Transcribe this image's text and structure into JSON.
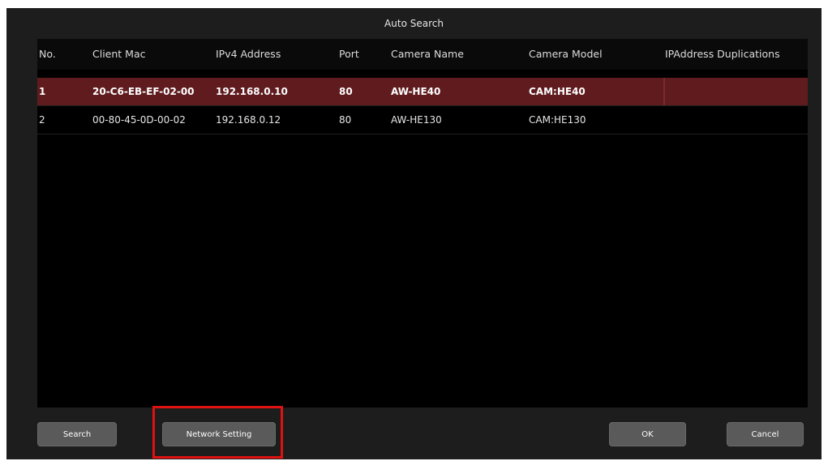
{
  "dialog": {
    "title": "Auto Search"
  },
  "table": {
    "headers": [
      "No.",
      "Client Mac",
      "IPv4 Address",
      "Port",
      "Camera Name",
      "Camera Model",
      "IPAddress Duplications"
    ],
    "rows": [
      [
        "1",
        "20-C6-EB-EF-02-00",
        "192.168.0.10",
        "80",
        "AW-HE40",
        "CAM:HE40",
        ""
      ],
      [
        "2",
        "00-80-45-0D-00-02",
        "192.168.0.12",
        "80",
        "AW-HE130",
        "CAM:HE130",
        ""
      ]
    ],
    "selected_row": 0
  },
  "buttons": {
    "search": "Search",
    "network_setting": "Network Setting",
    "ok": "OK",
    "cancel": "Cancel"
  },
  "colors": {
    "selected_row": "#5f1b1e",
    "highlight_box": "#e01111"
  }
}
